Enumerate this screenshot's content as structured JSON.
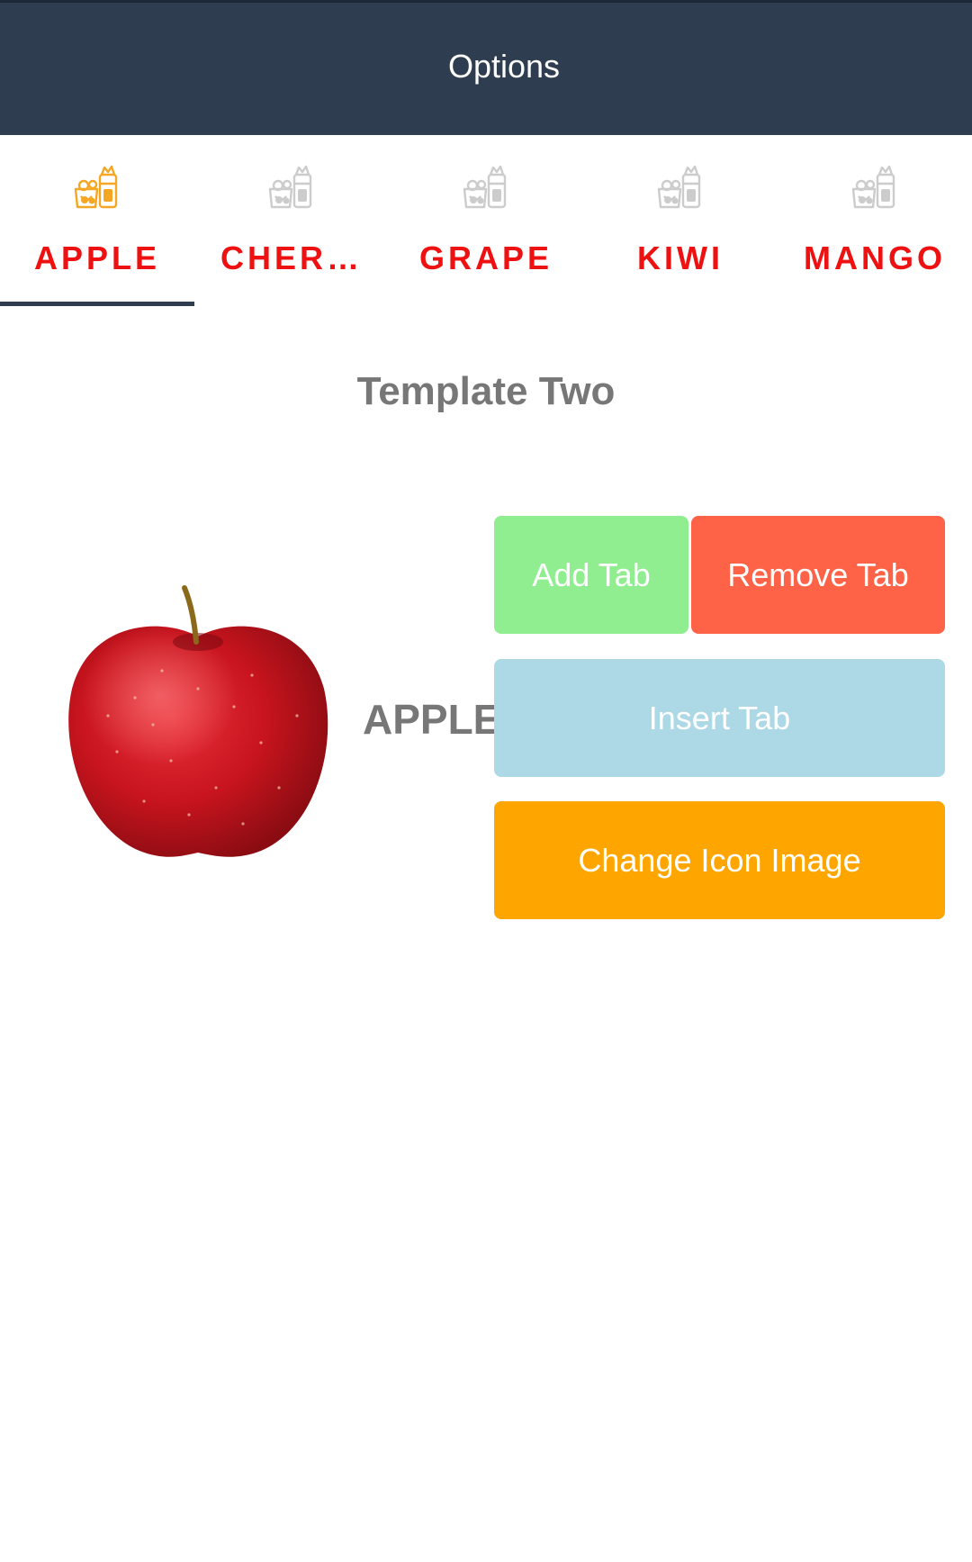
{
  "header": {
    "title": "Options",
    "background_color": "#2e3e50"
  },
  "tabs": [
    {
      "label": "APPLE",
      "icon": "fruit-basket-icon",
      "icon_color": "#f5a623",
      "selected": true
    },
    {
      "label": "CHER…",
      "icon": "fruit-basket-icon",
      "icon_color": "#cccccc",
      "selected": false
    },
    {
      "label": "GRAPE",
      "icon": "fruit-basket-icon",
      "icon_color": "#cccccc",
      "selected": false
    },
    {
      "label": "KIWI",
      "icon": "fruit-basket-icon",
      "icon_color": "#cccccc",
      "selected": false
    },
    {
      "label": "MANGO",
      "icon": "fruit-basket-icon",
      "icon_color": "#cccccc",
      "selected": false
    }
  ],
  "tab_label_color": "#ee1111",
  "content": {
    "title": "Template Two",
    "fruit_image": "apple-image",
    "fruit_label": "APPLE"
  },
  "buttons": {
    "add_tab": {
      "label": "Add Tab",
      "color": "#90ee90"
    },
    "remove_tab": {
      "label": "Remove Tab",
      "color": "#ff6347"
    },
    "insert_tab": {
      "label": "Insert Tab",
      "color": "#add8e6"
    },
    "change_icon": {
      "label": "Change Icon Image",
      "color": "#ffa500"
    }
  }
}
